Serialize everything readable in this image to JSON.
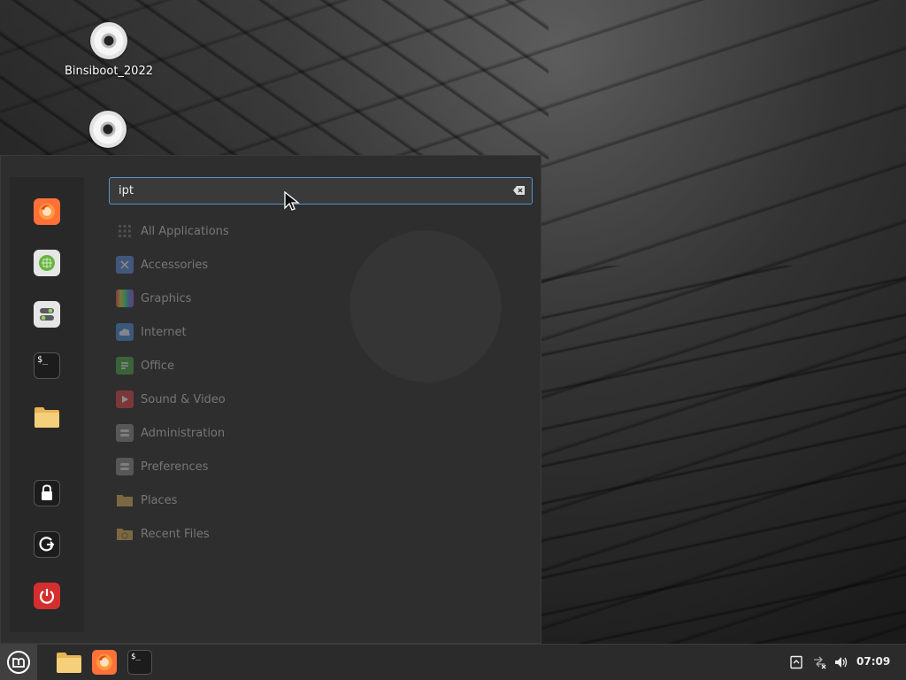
{
  "desktop": {
    "icons": [
      {
        "label": "Binsiboot_2022",
        "icon": "optical-disc-icon"
      },
      {
        "label": "",
        "icon": "optical-disc-icon"
      }
    ]
  },
  "menu": {
    "search": {
      "value": "ipt",
      "placeholder": ""
    },
    "favorites": [
      {
        "name": "firefox",
        "icon": "firefox-icon"
      },
      {
        "name": "software-manager",
        "icon": "software-manager-icon"
      },
      {
        "name": "system-settings",
        "icon": "settings-toggle-icon"
      },
      {
        "name": "terminal",
        "icon": "terminal-icon"
      },
      {
        "name": "files",
        "icon": "folder-icon"
      },
      {
        "name": "lock-screen",
        "icon": "lock-icon"
      },
      {
        "name": "logout",
        "icon": "logout-icon"
      },
      {
        "name": "quit",
        "icon": "power-icon"
      }
    ],
    "categories": [
      {
        "label": "All Applications",
        "icon": "grid-icon",
        "color": "#555555"
      },
      {
        "label": "Accessories",
        "icon": "accessories-icon",
        "color": "#5b8ad8"
      },
      {
        "label": "Graphics",
        "icon": "graphics-icon",
        "color": "#c04dd6"
      },
      {
        "label": "Internet",
        "icon": "internet-cloud-icon",
        "color": "#4a8bd6"
      },
      {
        "label": "Office",
        "icon": "office-icon",
        "color": "#4aa54a"
      },
      {
        "label": "Sound & Video",
        "icon": "media-play-icon",
        "color": "#d84545"
      },
      {
        "label": "Administration",
        "icon": "administration-icon",
        "color": "#8a8a8a"
      },
      {
        "label": "Preferences",
        "icon": "preferences-icon",
        "color": "#8a8a8a"
      },
      {
        "label": "Places",
        "icon": "places-folder-icon",
        "color": "#b0904a"
      },
      {
        "label": "Recent Files",
        "icon": "recent-files-icon",
        "color": "#b0904a"
      }
    ]
  },
  "panel": {
    "launchers": [
      {
        "name": "files",
        "icon": "folder-icon"
      },
      {
        "name": "firefox",
        "icon": "firefox-icon"
      },
      {
        "name": "terminal",
        "icon": "terminal-icon"
      }
    ],
    "tray": [
      "clipboard-icon",
      "network-disconnected-icon",
      "volume-icon"
    ],
    "clock": "07:09"
  },
  "terminal_prompt": "$_"
}
